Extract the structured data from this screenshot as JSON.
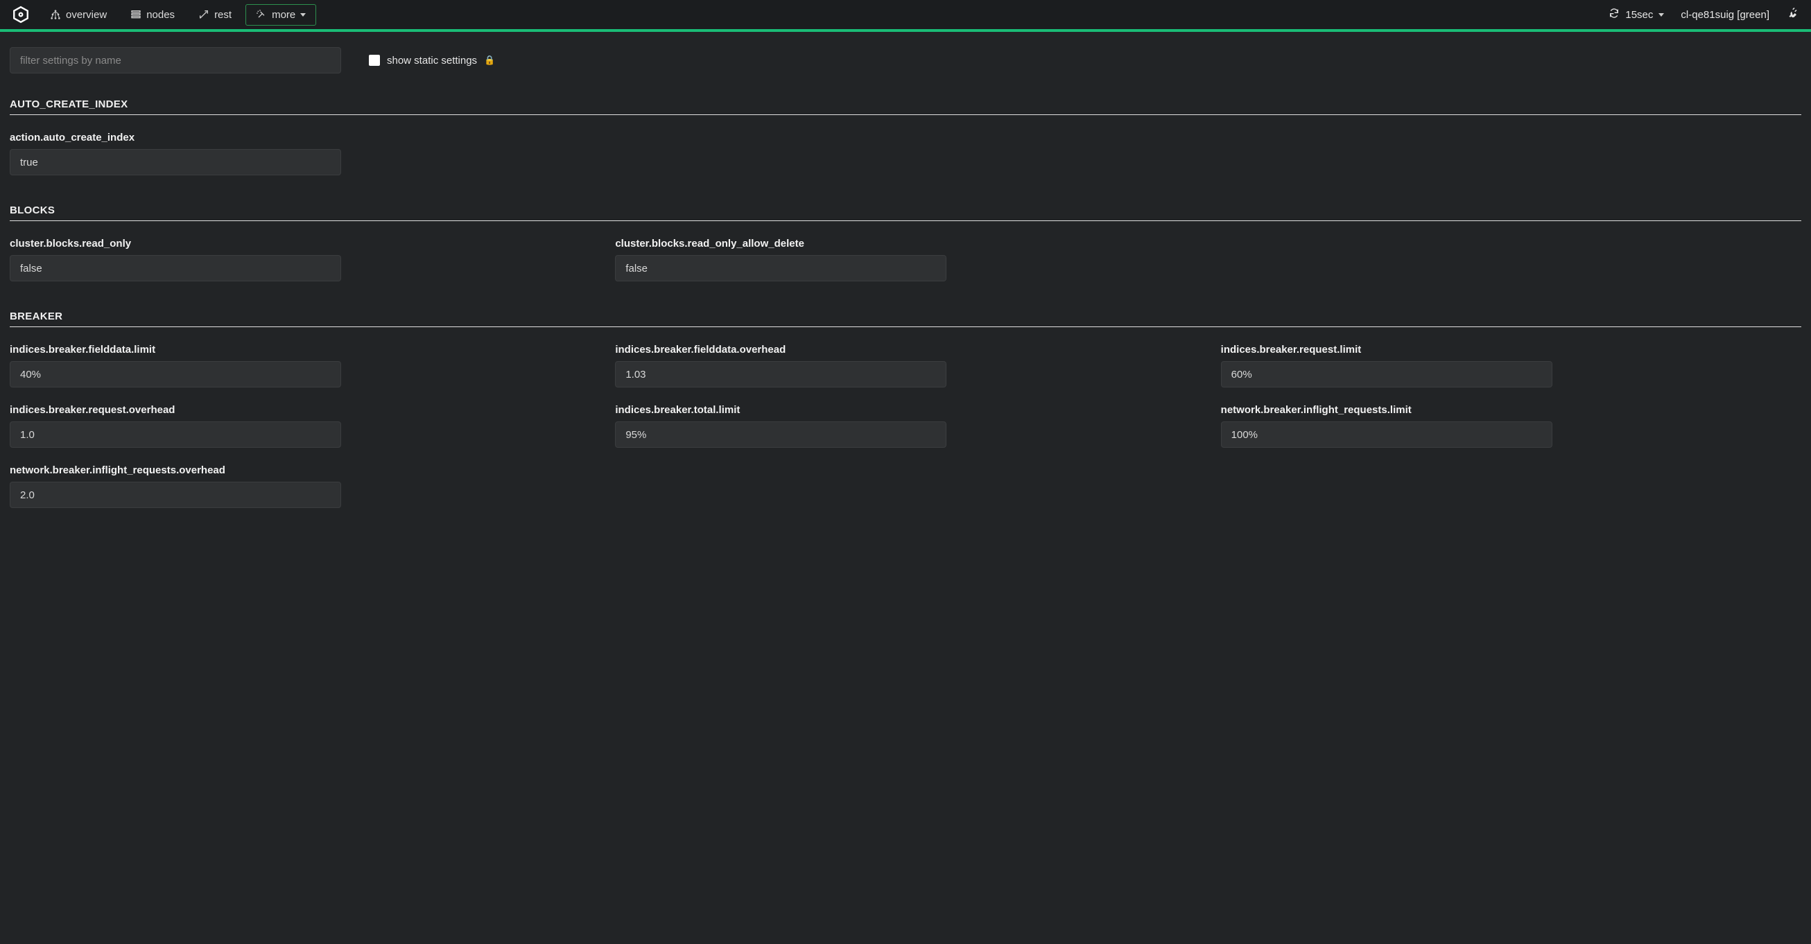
{
  "nav": {
    "overview": "overview",
    "nodes": "nodes",
    "rest": "rest",
    "more": "more"
  },
  "refresh": {
    "label": "15sec"
  },
  "cluster": {
    "label": "cl-qe81suig [green]"
  },
  "filter": {
    "placeholder": "filter settings by name"
  },
  "static_toggle": {
    "label": "show static settings"
  },
  "sections": {
    "auto_create_index": {
      "title": "AUTO_CREATE_INDEX",
      "items": [
        {
          "key": "action.auto_create_index",
          "value": "true"
        }
      ]
    },
    "blocks": {
      "title": "BLOCKS",
      "items": [
        {
          "key": "cluster.blocks.read_only",
          "value": "false"
        },
        {
          "key": "cluster.blocks.read_only_allow_delete",
          "value": "false"
        }
      ]
    },
    "breaker": {
      "title": "BREAKER",
      "items": [
        {
          "key": "indices.breaker.fielddata.limit",
          "value": "40%"
        },
        {
          "key": "indices.breaker.fielddata.overhead",
          "value": "1.03"
        },
        {
          "key": "indices.breaker.request.limit",
          "value": "60%"
        },
        {
          "key": "indices.breaker.request.overhead",
          "value": "1.0"
        },
        {
          "key": "indices.breaker.total.limit",
          "value": "95%"
        },
        {
          "key": "network.breaker.inflight_requests.limit",
          "value": "100%"
        },
        {
          "key": "network.breaker.inflight_requests.overhead",
          "value": "2.0"
        }
      ]
    }
  }
}
